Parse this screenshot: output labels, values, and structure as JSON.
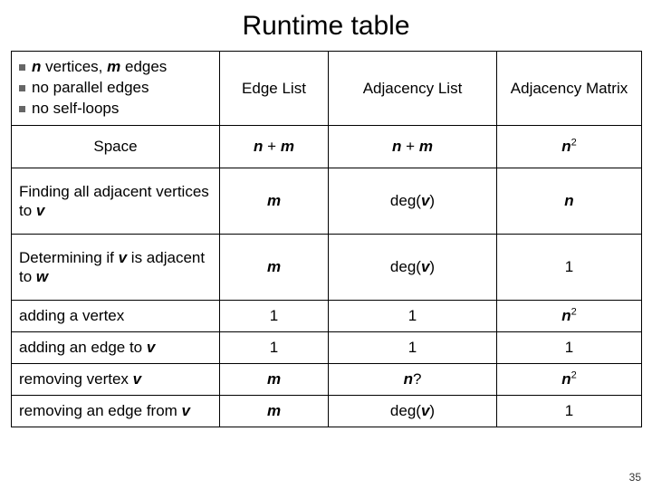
{
  "title": "Runtime table",
  "assumptions": {
    "a1_pre": "n",
    "a1_mid": " vertices, ",
    "a1_m": "m",
    "a1_post": " edges",
    "a2": "no parallel edges",
    "a3": "no self-loops"
  },
  "columns": {
    "edge_list": "Edge List",
    "adj_list": "Adjacency List",
    "adj_matrix": "Adjacency Matrix"
  },
  "rows": [
    {
      "label_key": "space",
      "label_plain": "Space"
    },
    {
      "label_key": "find_adj",
      "label_plain": "Finding all adjacent vertices to v"
    },
    {
      "label_key": "is_adj",
      "label_plain": "Determining if v is adjacent to w"
    },
    {
      "label_key": "add_v",
      "label_plain": "adding a vertex"
    },
    {
      "label_key": "add_e",
      "label_plain": "adding an edge to v"
    },
    {
      "label_key": "rem_v",
      "label_plain": "removing vertex v"
    },
    {
      "label_key": "rem_e",
      "label_plain": "removing an edge from v"
    }
  ],
  "chart_data": {
    "type": "table",
    "columns": [
      "Edge List",
      "Adjacency List",
      "Adjacency Matrix"
    ],
    "rows": {
      "Space": [
        "n + m",
        "n + m",
        "n^2"
      ],
      "Finding all adjacent vertices to v": [
        "m",
        "deg(v)",
        "n"
      ],
      "Determining if v is adjacent to w": [
        "m",
        "deg(v)",
        "1"
      ],
      "adding a vertex": [
        "1",
        "1",
        "n^2"
      ],
      "adding an edge to v": [
        "1",
        "1",
        "1"
      ],
      "removing vertex v": [
        "m",
        "n?",
        "n^2"
      ],
      "removing an edge from v": [
        "m",
        "deg(v)",
        "1"
      ]
    }
  },
  "text": {
    "space": "Space",
    "find_adj_pre": "Finding all adjacent vertices to ",
    "is_adj_pre": "Determining if ",
    "is_adj_mid": " is adjacent to ",
    "add_v": "adding a vertex",
    "add_e_pre": "adding an edge to ",
    "rem_v_pre": "removing vertex ",
    "rem_e_pre": "removing an edge from ",
    "n": "n",
    "m": "m",
    "v": "v",
    "w": "w",
    "plus": " + ",
    "one": "1",
    "degv_pre": "deg(",
    "degv_post": ")",
    "nq": "?",
    "sq": "2"
  },
  "page_number": "35"
}
